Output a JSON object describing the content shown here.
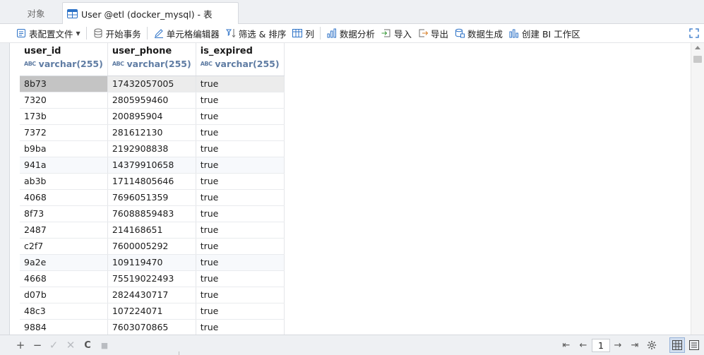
{
  "tabs": {
    "objects_label": "对象",
    "table_tab_label": "User @etl (docker_mysql) - 表"
  },
  "toolbar": {
    "table_config_label": "表配置文件",
    "begin_transaction_label": "开始事务",
    "cell_editor_label": "单元格编辑器",
    "filter_sort_label": "筛选 & 排序",
    "columns_label": "列",
    "data_analysis_label": "数据分析",
    "import_label": "导入",
    "export_label": "导出",
    "data_generation_label": "数据生成",
    "create_bi_label": "创建 BI 工作区"
  },
  "grid": {
    "columns": [
      {
        "name": "user_id",
        "type": "varchar(255)"
      },
      {
        "name": "user_phone",
        "type": "varchar(255)"
      },
      {
        "name": "is_expired",
        "type": "varchar(255)"
      }
    ],
    "type_glyph": "ABC",
    "rows": [
      [
        "8b73",
        "17432057005",
        "true"
      ],
      [
        "7320",
        "2805959460",
        "true"
      ],
      [
        "173b",
        "200895904",
        "true"
      ],
      [
        "7372",
        "281612130",
        "true"
      ],
      [
        "b9ba",
        "2192908838",
        "true"
      ],
      [
        "941a",
        "14379910658",
        "true"
      ],
      [
        "ab3b",
        "17114805646",
        "true"
      ],
      [
        "4068",
        "7696051359",
        "true"
      ],
      [
        "8f73",
        "76088859483",
        "true"
      ],
      [
        "2487",
        "214168651",
        "true"
      ],
      [
        "c2f7",
        "7600005292",
        "true"
      ],
      [
        "9a2e",
        "109119470",
        "true"
      ],
      [
        "4668",
        "75519022493",
        "true"
      ],
      [
        "d07b",
        "2824430717",
        "true"
      ],
      [
        "48c3",
        "107224071",
        "true"
      ],
      [
        "9884",
        "7603070865",
        "true"
      ]
    ]
  },
  "pagination": {
    "current_page": "1"
  },
  "bottom": {
    "add_glyph": "+",
    "remove_glyph": "−",
    "apply_glyph": "✓",
    "cancel_glyph": "✕",
    "refresh_glyph": "C",
    "stop_glyph": "■",
    "first_glyph": "⇤",
    "prev_glyph": "←",
    "next_glyph": "→",
    "last_glyph": "⇥"
  },
  "colors": {
    "accent_blue": "#2c72c7",
    "type_text": "#5f7ca3",
    "selected_cell": "#c4c4c4"
  }
}
